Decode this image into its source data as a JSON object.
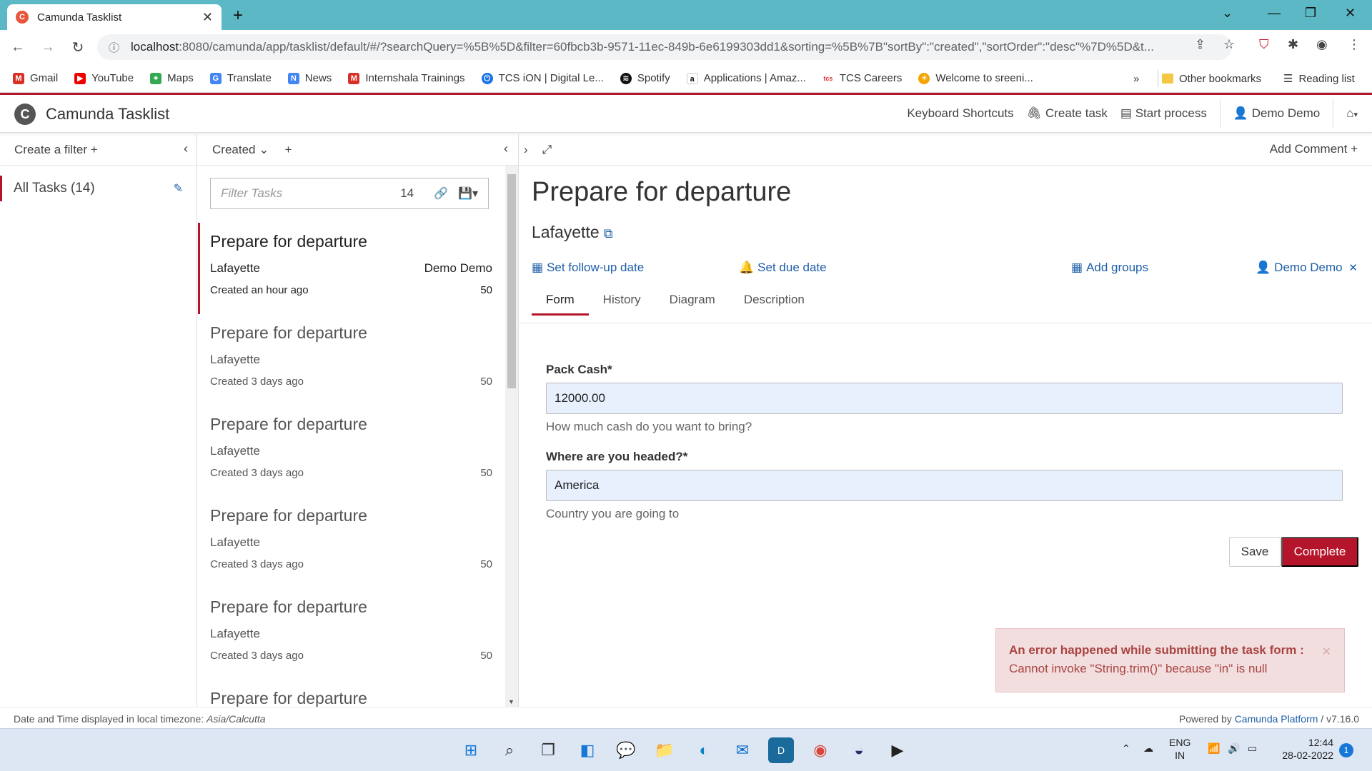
{
  "browser": {
    "tab_title": "Camunda Tasklist",
    "url_host": "localhost",
    "url_rest": ":8080/camunda/app/tasklist/default/#/?searchQuery=%5B%5D&filter=60fbcb3b-9571-11ec-849b-6e6199303dd1&sorting=%5B%7B\"sortBy\":\"created\",\"sortOrder\":\"desc\"%7D%5D&t...",
    "bookmarks": [
      "Gmail",
      "YouTube",
      "Maps",
      "Translate",
      "News",
      "Internshala Trainings",
      "TCS iON | Digital Le...",
      "Spotify",
      "Applications | Amaz...",
      "TCS Careers",
      "Welcome to sreeni..."
    ],
    "more_bookmarks": "»",
    "other_bookmarks": "Other bookmarks",
    "reading_list": "Reading list"
  },
  "header": {
    "title": "Camunda Tasklist",
    "keyboard_shortcuts": "Keyboard Shortcuts",
    "create_task": "Create task",
    "start_process": "Start process",
    "user": "Demo Demo"
  },
  "filters": {
    "create_label": "Create a filter +",
    "items": [
      {
        "label": "All Tasks (14)"
      }
    ]
  },
  "list": {
    "sort_label": "Created",
    "add": "+",
    "search_placeholder": "Filter Tasks",
    "count": "14",
    "tasks": [
      {
        "name": "Prepare for departure",
        "process": "Lafayette",
        "assignee": "Demo Demo",
        "created": "Created an hour ago",
        "priority": "50"
      },
      {
        "name": "Prepare for departure",
        "process": "Lafayette",
        "assignee": "",
        "created": "Created 3 days ago",
        "priority": "50"
      },
      {
        "name": "Prepare for departure",
        "process": "Lafayette",
        "assignee": "",
        "created": "Created 3 days ago",
        "priority": "50"
      },
      {
        "name": "Prepare for departure",
        "process": "Lafayette",
        "assignee": "",
        "created": "Created 3 days ago",
        "priority": "50"
      },
      {
        "name": "Prepare for departure",
        "process": "Lafayette",
        "assignee": "",
        "created": "Created 3 days ago",
        "priority": "50"
      },
      {
        "name": "Prepare for departure",
        "process": "",
        "assignee": "",
        "created": "",
        "priority": ""
      }
    ]
  },
  "detail": {
    "add_comment": "Add Comment +",
    "title": "Prepare for departure",
    "process": "Lafayette",
    "follow_up": "Set follow-up date",
    "due_date": "Set due date",
    "add_groups": "Add groups",
    "assignee": "Demo Demo",
    "tabs": [
      "Form",
      "History",
      "Diagram",
      "Description"
    ],
    "form": {
      "cash_label": "Pack Cash*",
      "cash_value": "12000.00",
      "cash_help": "How much cash do you want to bring?",
      "dest_label": "Where are you headed?*",
      "dest_value": "America",
      "dest_help": "Country you are going to"
    },
    "save": "Save",
    "complete": "Complete",
    "error_title": "An error happened while submitting the task form :",
    "error_msg": "Cannot invoke \"String.trim()\" because \"in\" is null"
  },
  "footer": {
    "tz_prefix": "Date and Time displayed in local timezone: ",
    "tz": "Asia/Calcutta",
    "powered_prefix": "Powered by ",
    "platform": "Camunda Platform",
    "version": " / v7.16.0"
  },
  "taskbar": {
    "lang1": "ENG",
    "lang2": "IN",
    "time": "12:44",
    "date": "28-02-2022",
    "notif": "1"
  },
  "colors": {
    "brand": "#b5152b",
    "link": "#1f5fa8",
    "chrome": "#5cb8c4"
  }
}
